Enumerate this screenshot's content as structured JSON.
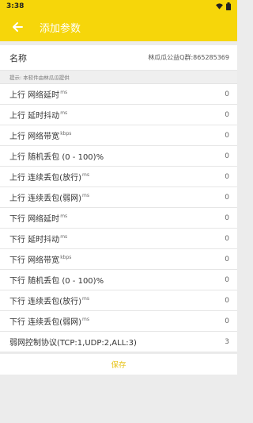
{
  "status_bar": {
    "time": "3:38"
  },
  "app_bar": {
    "title": "添加参数"
  },
  "name_field": {
    "label": "名称",
    "value": "林瓜瓜公益Q群:865285369"
  },
  "tip": "提示: 本软件由林瓜瓜提供",
  "params": [
    {
      "label": "上行 网络延时",
      "unit": "ms",
      "value": "0"
    },
    {
      "label": "上行 延时抖动",
      "unit": "ms",
      "value": "0"
    },
    {
      "label": "上行 网络带宽",
      "unit": "kbps",
      "value": "0"
    },
    {
      "label": "上行 随机丢包 (0 - 100)%",
      "unit": "",
      "value": "0"
    },
    {
      "label": "上行 连续丢包(放行)",
      "unit": "ms",
      "value": "0"
    },
    {
      "label": "上行 连续丢包(弱网)",
      "unit": "ms",
      "value": "0"
    },
    {
      "label": "下行 网络延时",
      "unit": "ms",
      "value": "0"
    },
    {
      "label": "下行 延时抖动",
      "unit": "ms",
      "value": "0"
    },
    {
      "label": "下行 网络带宽",
      "unit": "kbps",
      "value": "0"
    },
    {
      "label": "下行 随机丢包 (0 - 100)%",
      "unit": "",
      "value": "0"
    },
    {
      "label": "下行 连续丢包(放行)",
      "unit": "ms",
      "value": "0"
    },
    {
      "label": "下行 连续丢包(弱网)",
      "unit": "ms",
      "value": "0"
    },
    {
      "label": "弱网控制协议(TCP:1,UDP:2,ALL:3)",
      "unit": "",
      "value": "3"
    }
  ],
  "save_label": "保存",
  "colors": {
    "accent": "#f6d60a",
    "save_text": "#e7c31a"
  },
  "icons": [
    "wifi-icon",
    "battery-icon",
    "back-arrow-icon"
  ]
}
